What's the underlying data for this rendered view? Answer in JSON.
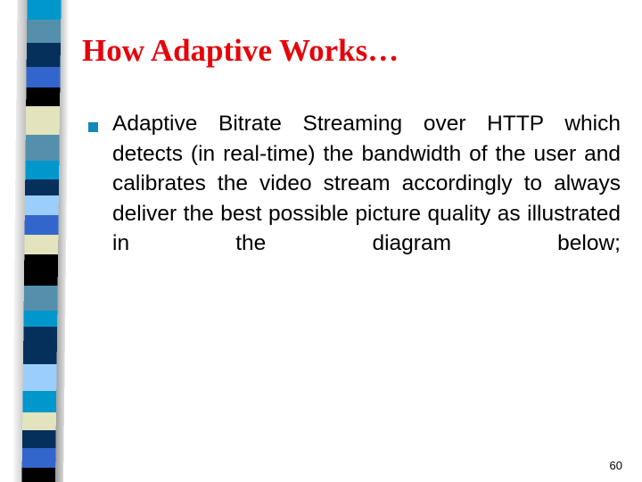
{
  "slide": {
    "title": "How Adaptive Works…",
    "title_color": "#E4050B",
    "background_color": "#FFFFFF",
    "page_number": "60"
  },
  "body": {
    "bullets": [
      {
        "marker": "square-bullet",
        "marker_color": "#1289B8",
        "text": "Adaptive Bitrate Streaming over HTTP which detects (in real-time) the bandwidth of the user and calibrates the video stream accordingly to always deliver the best possible picture quality as illustrated in the diagram below;"
      }
    ]
  },
  "decoration": {
    "name": "left-stripe-band",
    "segments": [
      {
        "color": "#0097CC",
        "start": 0,
        "end": 22
      },
      {
        "color": "#5490AC",
        "start": 22,
        "end": 48
      },
      {
        "color": "#06305C",
        "start": 48,
        "end": 75
      },
      {
        "color": "#3366CC",
        "start": 75,
        "end": 98
      },
      {
        "color": "#000000",
        "start": 98,
        "end": 119
      },
      {
        "color": "#E3E3BE",
        "start": 119,
        "end": 151
      },
      {
        "color": "#5490AC",
        "start": 151,
        "end": 180
      },
      {
        "color": "#0097CC",
        "start": 180,
        "end": 201
      },
      {
        "color": "#06305C",
        "start": 201,
        "end": 219
      },
      {
        "color": "#9CCEFB",
        "start": 219,
        "end": 241
      },
      {
        "color": "#3366CC",
        "start": 241,
        "end": 263
      },
      {
        "color": "#E3E3BE",
        "start": 263,
        "end": 285
      },
      {
        "color": "#000000",
        "start": 285,
        "end": 320
      },
      {
        "color": "#5490AC",
        "start": 320,
        "end": 348
      },
      {
        "color": "#0097CC",
        "start": 348,
        "end": 366
      },
      {
        "color": "#06305C",
        "start": 366,
        "end": 408
      },
      {
        "color": "#9CCEFB",
        "start": 408,
        "end": 438
      },
      {
        "color": "#0097CC",
        "start": 438,
        "end": 462
      },
      {
        "color": "#E3E3BE",
        "start": 462,
        "end": 482
      },
      {
        "color": "#06305C",
        "start": 482,
        "end": 502
      },
      {
        "color": "#3366CC",
        "start": 502,
        "end": 524
      },
      {
        "color": "#000000",
        "start": 524,
        "end": 540
      }
    ]
  }
}
